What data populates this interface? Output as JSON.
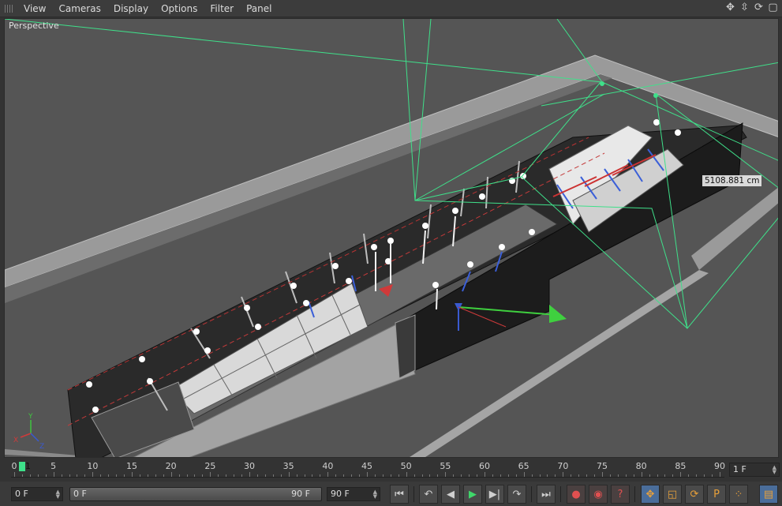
{
  "menubar": {
    "items": [
      "View",
      "Cameras",
      "Display",
      "Options",
      "Filter",
      "Panel"
    ],
    "nav_icons": [
      "move-view-icon",
      "zoom-view-icon",
      "rotate-view-icon",
      "maximize-view-icon"
    ]
  },
  "viewport": {
    "label": "Perspective",
    "measurement": "5108.881 cm",
    "colors": {
      "background": "#555555",
      "camera_frustum": "#3fe08a",
      "axis_y": "#3fc53f",
      "axis_x": "#d03a3a",
      "axis_z": "#3a5ad0"
    }
  },
  "axis_gizmo": {
    "y": "Y",
    "x": "X",
    "z": "Z"
  },
  "timeline": {
    "ticks": [
      "0",
      "5",
      "10",
      "15",
      "20",
      "25",
      "30",
      "35",
      "40",
      "45",
      "50",
      "55",
      "60",
      "65",
      "70",
      "75",
      "80",
      "85",
      "90"
    ],
    "current_frame_label": "1",
    "frame_end_field": "1 F"
  },
  "transport": {
    "start_field": "0 F",
    "range_start": "0 F",
    "range_end": "90 F",
    "end_field": "90 F"
  }
}
